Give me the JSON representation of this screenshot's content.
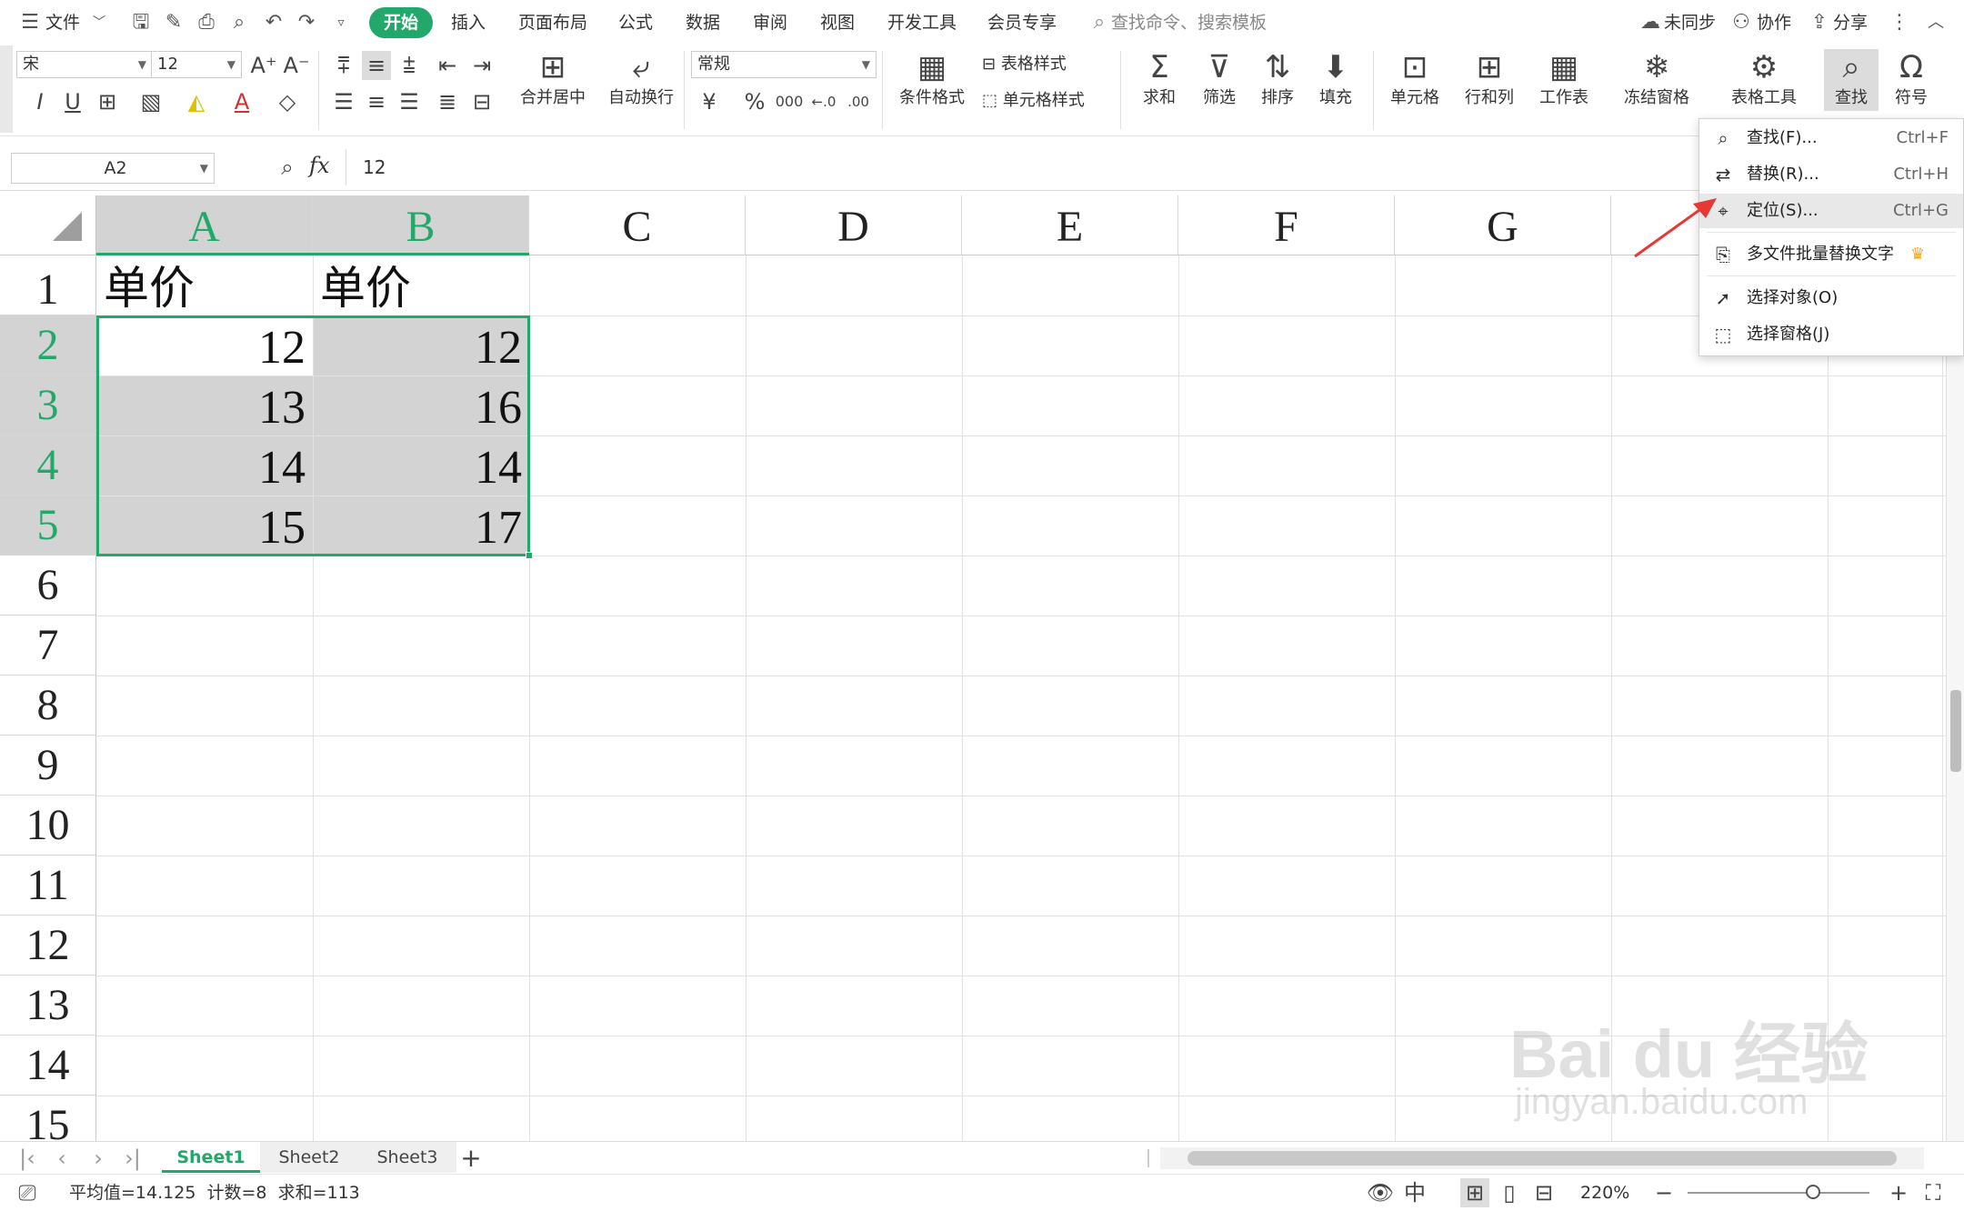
{
  "menubar": {
    "file": "文件",
    "tabs": [
      "开始",
      "插入",
      "页面布局",
      "公式",
      "数据",
      "审阅",
      "视图",
      "开发工具",
      "会员专享"
    ],
    "search_placeholder": "查找命令、搜索模板",
    "sync": "未同步",
    "collab": "协作",
    "share": "分享"
  },
  "ribbon": {
    "font_name": "宋",
    "font_size": "12",
    "merge": "合并居中",
    "wrap": "自动换行",
    "number_format": "常规",
    "cond_format": "条件格式",
    "table_style": "表格样式",
    "cell_style": "单元格样式",
    "sum": "求和",
    "filter": "筛选",
    "sort": "排序",
    "fill": "填充",
    "cell": "单元格",
    "row_col": "行和列",
    "worksheet": "工作表",
    "freeze": "冻结窗格",
    "table_tools": "表格工具",
    "find": "查找",
    "symbol": "符号"
  },
  "formula_bar": {
    "name_box": "A2",
    "fx": "fx",
    "value": "12"
  },
  "grid": {
    "columns": [
      "A",
      "B",
      "C",
      "D",
      "E",
      "F",
      "G"
    ],
    "rows": [
      "1",
      "2",
      "3",
      "4",
      "5",
      "6",
      "7",
      "8",
      "9",
      "10",
      "11",
      "12",
      "13",
      "14",
      "15"
    ],
    "cells": {
      "A1": "单价",
      "B1": "单价",
      "A2": "12",
      "B2": "12",
      "A3": "13",
      "B3": "16",
      "A4": "14",
      "B4": "14",
      "A5": "15",
      "B5": "17"
    }
  },
  "sheets": [
    "Sheet1",
    "Sheet2",
    "Sheet3"
  ],
  "status": {
    "summary": "平均值=14.125  计数=8  求和=113",
    "zoom": "220%"
  },
  "find_menu": {
    "items": [
      {
        "label": "查找(F)...",
        "shortcut": "Ctrl+F",
        "icon": "search-icon"
      },
      {
        "label": "替换(R)...",
        "shortcut": "Ctrl+H",
        "icon": "replace-icon"
      },
      {
        "label": "定位(S)...",
        "shortcut": "Ctrl+G",
        "icon": "goto-icon"
      },
      {
        "label": "多文件批量替换文字",
        "shortcut": "",
        "icon": "batch-replace-icon"
      },
      {
        "label": "选择对象(O)",
        "shortcut": "",
        "icon": "select-object-icon"
      },
      {
        "label": "选择窗格(J)",
        "shortcut": "",
        "icon": "select-pane-icon"
      }
    ]
  },
  "watermark": {
    "brand": "Bai du 经验",
    "url": "jingyan.baidu.com"
  },
  "colors": {
    "accent": "#23a86b",
    "selection_fill": "#d3d3d3",
    "arrow": "#e53935"
  }
}
